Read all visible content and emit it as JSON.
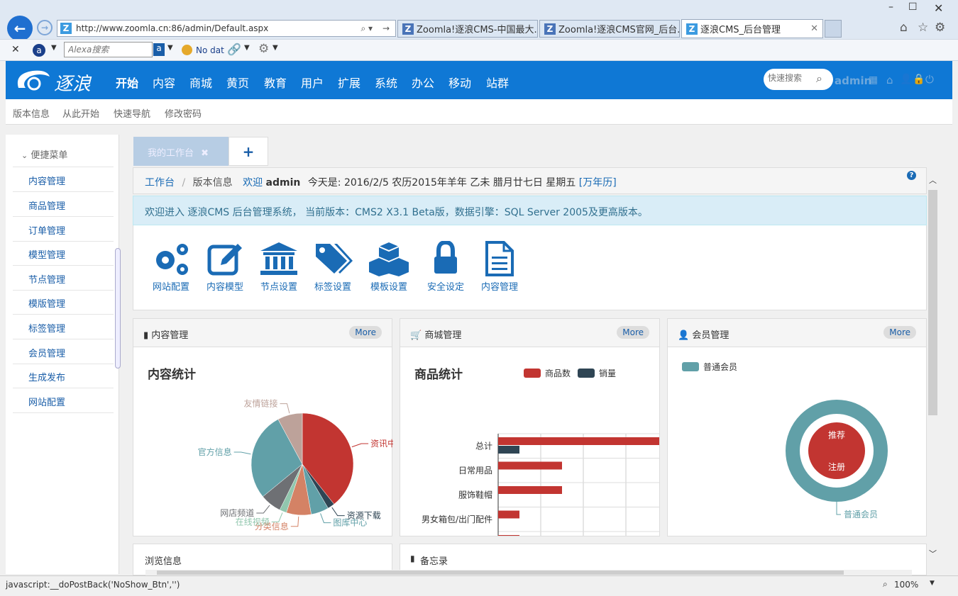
{
  "browser": {
    "address": "http://www.zoomla.cn:86/admin/Default.aspx",
    "tabs": [
      "Zoomla!逐浪CMS-中国最大...",
      "Zoomla!逐浪CMS官网_后台...",
      "逐浪CMS_后台管理"
    ],
    "alexa_placeholder": "Alexa搜索",
    "no_data": "No data",
    "status_text": "javascript:__doPostBack('NoShow_Btn','')",
    "zoom": "100%"
  },
  "header": {
    "logo": "逐浪",
    "nav": [
      "开始",
      "内容",
      "商城",
      "黄页",
      "教育",
      "用户",
      "扩展",
      "系统",
      "办公",
      "移动",
      "站群"
    ],
    "search_placeholder": "快速搜索",
    "user": "admin"
  },
  "subnav": [
    "版本信息",
    "从此开始",
    "快速导航",
    "修改密码"
  ],
  "sidebar": {
    "title": "便捷菜单",
    "items": [
      "内容管理",
      "商品管理",
      "订单管理",
      "模型管理",
      "节点管理",
      "模版管理",
      "标签管理",
      "会员管理",
      "生成发布",
      "网站配置"
    ]
  },
  "workbench": {
    "tab_label": "我的工作台",
    "add_label": "+",
    "crumb_home": "工作台",
    "crumb_sep": "/",
    "crumb_current": "版本信息",
    "welcome": "欢迎",
    "user": "admin",
    "date_text": "今天是: 2016/2/5 农历2015年羊年 乙未 腊月廿七日 星期五",
    "calendar_link": "[万年历]",
    "help": "?",
    "info": "欢迎进入 逐浪CMS 后台管理系统， 当前版本：CMS2 X3.1 Beta版，数据引擎：SQL Server 2005及更高版本。"
  },
  "quick_icons": [
    {
      "label": "网站配置",
      "icon": "gears-icon"
    },
    {
      "label": "内容模型",
      "icon": "edit-icon"
    },
    {
      "label": "节点设置",
      "icon": "bank-icon"
    },
    {
      "label": "标签设置",
      "icon": "tags-icon"
    },
    {
      "label": "模板设置",
      "icon": "cubes-icon"
    },
    {
      "label": "安全设定",
      "icon": "lock-icon"
    },
    {
      "label": "内容管理",
      "icon": "file-text-icon"
    }
  ],
  "panels": {
    "content": {
      "title": "内容管理",
      "more": "More",
      "chart_title": "内容统计"
    },
    "shop": {
      "title": "商城管理",
      "more": "More",
      "chart_title": "商品统计"
    },
    "member": {
      "title": "会员管理",
      "more": "More"
    },
    "browse": {
      "title": "浏览信息"
    },
    "memo": {
      "title": "备忘录"
    }
  },
  "colors": {
    "blue": "#0f78d5",
    "red": "#c23531",
    "navy": "#2f4554",
    "teal": "#61a0a8",
    "orange": "#d48265",
    "green": "#91c7ae",
    "tan": "#bda29a",
    "gray": "#6e7074"
  },
  "chart_data": [
    {
      "type": "pie",
      "title": "内容统计",
      "labels": [
        "资讯中心",
        "资源下载",
        "图库中心",
        "分类信息",
        "在线视频",
        "网店频道",
        "官方信息",
        "友情链接"
      ],
      "values": [
        35,
        2,
        5,
        7,
        2,
        6,
        25,
        7
      ],
      "colors": [
        "#c23531",
        "#2f4554",
        "#61a0a8",
        "#d48265",
        "#91c7ae",
        "#6e7074",
        "#61a0a8",
        "#bda29a"
      ]
    },
    {
      "type": "bar",
      "title": "商品统计",
      "orientation": "horizontal",
      "categories": [
        "总计",
        "日常用品",
        "服饰鞋帽",
        "男女箱包/出门配件",
        ""
      ],
      "series": [
        {
          "name": "商品数",
          "values": [
            8,
            3,
            3,
            1,
            1
          ],
          "color": "#c23531"
        },
        {
          "name": "销量",
          "values": [
            1,
            0,
            0,
            0,
            1
          ],
          "color": "#2f4554"
        }
      ],
      "x_ticks": [
        "0",
        "2",
        "4",
        "6"
      ],
      "xlim": [
        0,
        8
      ]
    },
    {
      "type": "pie",
      "title": "",
      "legend": [
        "普通会员"
      ],
      "ring_label": "普通会员",
      "inner_labels": [
        "推荐",
        "注册"
      ],
      "values": [
        1
      ]
    }
  ]
}
